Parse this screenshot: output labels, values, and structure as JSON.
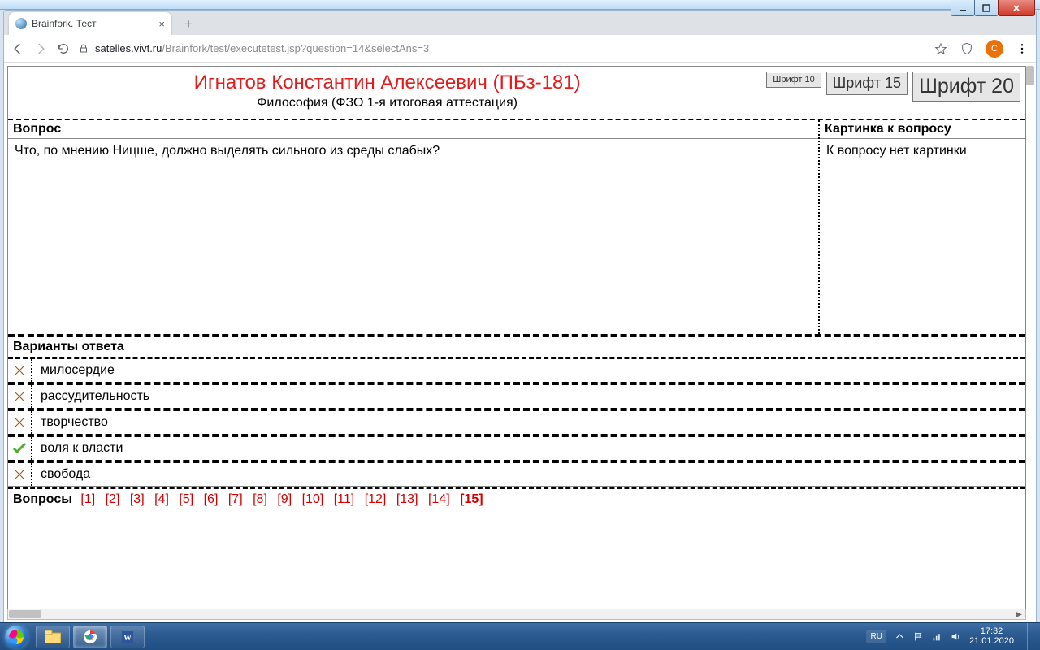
{
  "window": {
    "tab_title": "Brainfork. Тест"
  },
  "omnibox": {
    "host": "satelles.vivt.ru",
    "path": "/Brainfork/test/executetest.jsp?question=14&selectAns=3"
  },
  "avatar_letter": "С",
  "header": {
    "student": "Игнатов Константин Алексеевич (ПБз-181)",
    "course": "Философия (ФЗО 1-я итоговая аттестация)",
    "font_buttons": {
      "f10": "Шрифт 10",
      "f15": "Шрифт 15",
      "f20": "Шрифт 20"
    }
  },
  "question": {
    "label": "Вопрос",
    "text": "Что, по мнению Ницше, должно выделять сильного из среды слабых?",
    "picture_label": "Картинка к вопросу",
    "no_picture": "К вопросу нет картинки"
  },
  "answers": {
    "label": "Варианты ответа",
    "items": [
      {
        "text": "милосердие",
        "correct": false
      },
      {
        "text": "рассудительность",
        "correct": false
      },
      {
        "text": "творчество",
        "correct": false
      },
      {
        "text": "воля к власти",
        "correct": true
      },
      {
        "text": "свобода",
        "correct": false
      }
    ]
  },
  "qnav": {
    "label": "Вопросы",
    "items": [
      "[1]",
      "[2]",
      "[3]",
      "[4]",
      "[5]",
      "[6]",
      "[7]",
      "[8]",
      "[9]",
      "[10]",
      "[11]",
      "[12]",
      "[13]",
      "[14]",
      "[15]"
    ],
    "current_index": 14
  },
  "taskbar": {
    "lang": "RU",
    "time": "17:32",
    "date": "21.01.2020"
  }
}
